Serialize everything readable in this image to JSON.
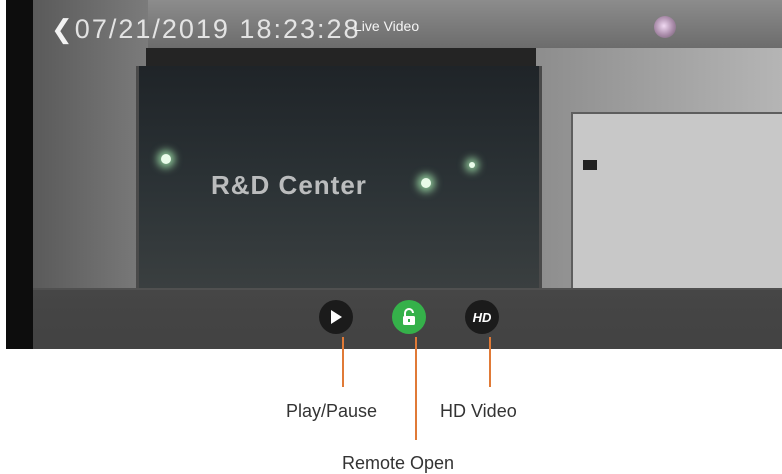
{
  "header": {
    "timestamp": "07/21/2019 18:23:28",
    "title": "Live Video"
  },
  "scene": {
    "sign_text": "R&D Center"
  },
  "controls": {
    "play_pause_icon": "play-icon",
    "remote_open_icon": "unlock-icon",
    "hd_label": "HD",
    "accent_color": "#35b14a"
  },
  "annotations": {
    "play_pause": "Play/Pause",
    "hd_video": "HD Video",
    "remote_open": "Remote Open",
    "pointer_color": "#e07a37"
  }
}
